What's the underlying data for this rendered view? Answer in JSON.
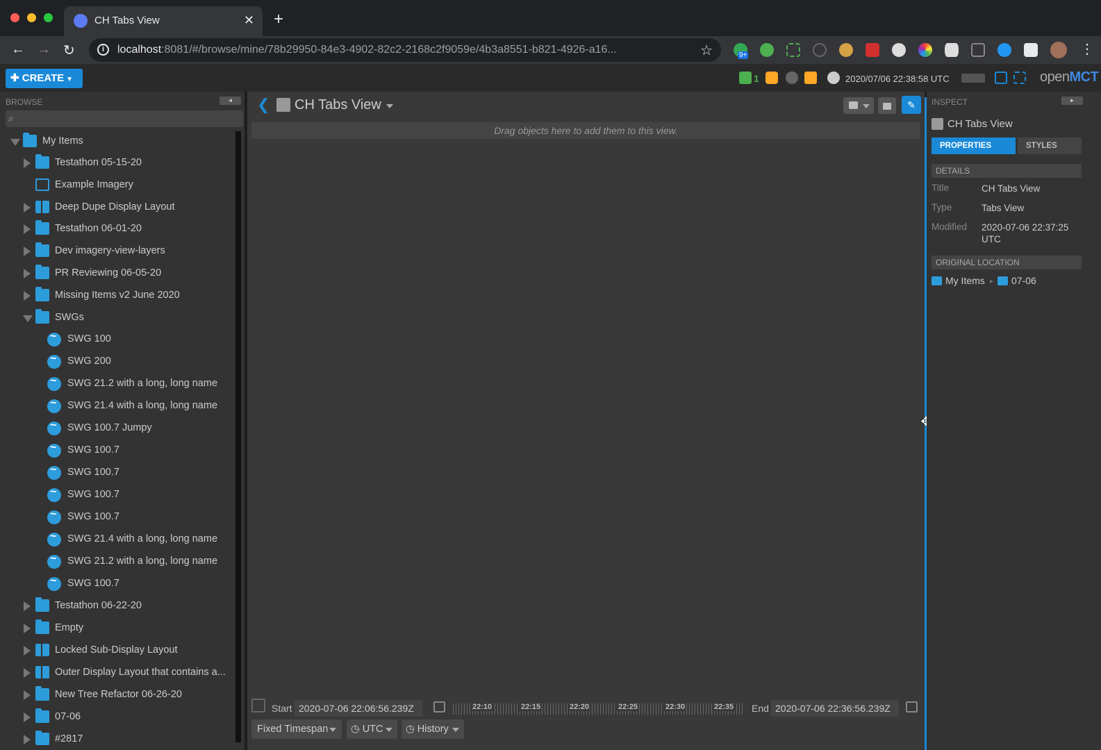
{
  "browser": {
    "tab_title": "CH Tabs View",
    "tab_close": "✕",
    "new_tab": "+",
    "url_host": "localhost",
    "url_rest": ":8081/#/browse/mine/78b29950-84e3-4902-82c2-2168c2f9059e/4b3a8551-b821-4926-a16...",
    "ext_badge": "9+"
  },
  "header": {
    "create_label": "CREATE",
    "indicator_count": "1",
    "clock": "2020/07/06 22:38:58 UTC",
    "logo_open": "open",
    "logo_mct": "MCT"
  },
  "browse": {
    "label": "BROWSE",
    "collapse": "◄",
    "items": [
      {
        "label": "My Items"
      },
      {
        "label": "Testathon 05-15-20"
      },
      {
        "label": "Example Imagery"
      },
      {
        "label": "Deep Dupe Display Layout"
      },
      {
        "label": "Testathon 06-01-20"
      },
      {
        "label": "Dev imagery-view-layers"
      },
      {
        "label": "PR Reviewing 06-05-20"
      },
      {
        "label": "Missing Items v2 June 2020"
      },
      {
        "label": "SWGs"
      },
      {
        "label": "SWG 100"
      },
      {
        "label": "SWG 200"
      },
      {
        "label": "SWG 21.2 with a long, long name"
      },
      {
        "label": "SWG 21.4 with a long, long name"
      },
      {
        "label": "SWG 100.7 Jumpy"
      },
      {
        "label": "SWG 100.7"
      },
      {
        "label": "SWG 100.7"
      },
      {
        "label": "SWG 100.7"
      },
      {
        "label": "SWG 100.7"
      },
      {
        "label": "SWG 21.4 with a long, long name"
      },
      {
        "label": "SWG 21.2 with a long, long name"
      },
      {
        "label": "SWG 100.7"
      },
      {
        "label": "Testathon 06-22-20"
      },
      {
        "label": "Empty"
      },
      {
        "label": "Locked Sub-Display Layout"
      },
      {
        "label": "Outer Display Layout that contains a..."
      },
      {
        "label": "New Tree Refactor 06-26-20"
      },
      {
        "label": "07-06"
      },
      {
        "label": "#2817"
      }
    ]
  },
  "main": {
    "title": "CH Tabs View",
    "drop_hint": "Drag objects here to add them to this view.",
    "start_label": "Start",
    "start_value": "2020-07-06 22:06:56.239Z",
    "end_label": "End",
    "end_value": "2020-07-06 22:36:56.239Z",
    "ticks": [
      "22:10",
      "22:15",
      "22:20",
      "22:25",
      "22:30",
      "22:35"
    ],
    "mode_button": "Fixed Timespan",
    "clock_button": "UTC",
    "history_button": "History"
  },
  "inspector": {
    "label": "INSPECT",
    "expand": "►",
    "title": "CH Tabs View",
    "tab_properties": "PROPERTIES",
    "tab_styles": "STYLES",
    "details_header": "DETAILS",
    "title_key": "Title",
    "title_value": "CH Tabs View",
    "type_key": "Type",
    "type_value": "Tabs View",
    "modified_key": "Modified",
    "modified_value": "2020-07-06 22:37:25 UTC",
    "original_location_header": "ORIGINAL LOCATION",
    "location_root": "My Items",
    "location_leaf": "07-06"
  }
}
